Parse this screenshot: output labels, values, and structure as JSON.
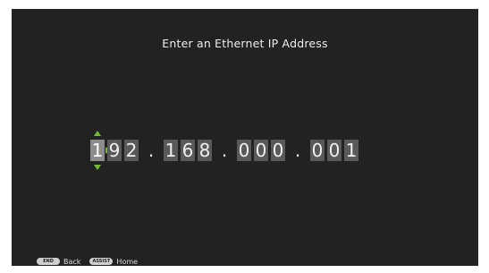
{
  "title": "Enter an Ethernet IP Address",
  "ip": {
    "octet1": [
      "1",
      "9",
      "2"
    ],
    "octet2": [
      "1",
      "6",
      "8"
    ],
    "octet3": [
      "0",
      "0",
      "0"
    ],
    "octet4": [
      "0",
      "0",
      "1"
    ],
    "separator": ".",
    "active_digit": "octet1.0"
  },
  "footer": {
    "back_key": "END",
    "back_label": "Back",
    "home_key": "ASSIST",
    "home_label": "Home"
  },
  "colors": {
    "background": "#222222",
    "digit_bg": "#595959",
    "active_digit_bg": "#8c8c8c",
    "arrow": "#6fbf3a"
  }
}
